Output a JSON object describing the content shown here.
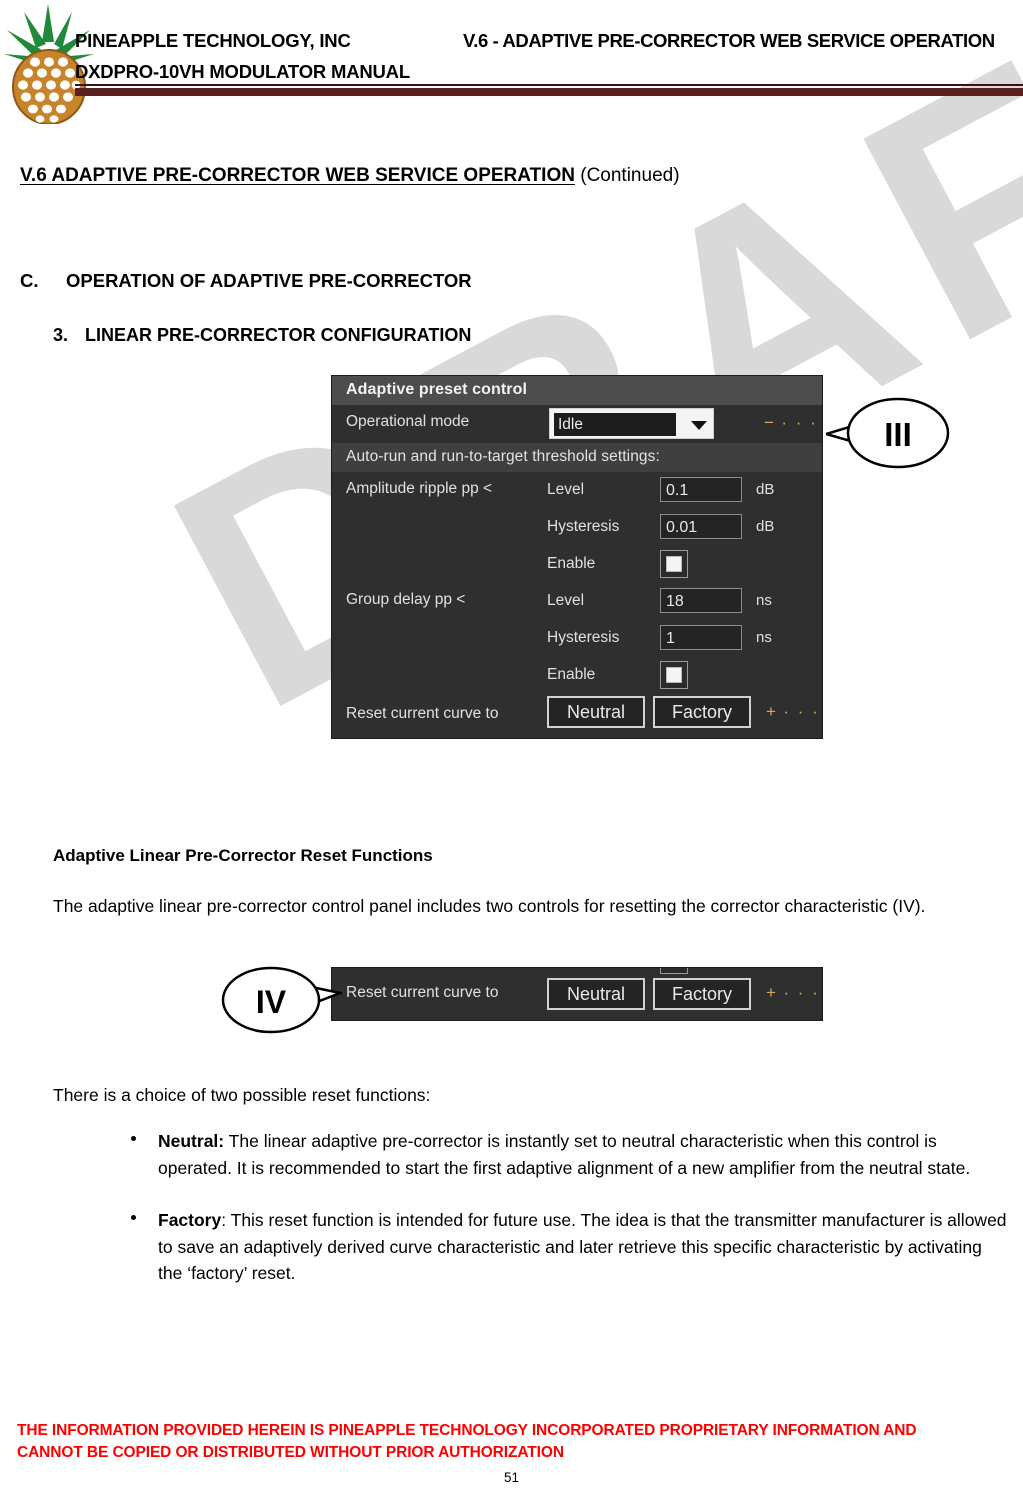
{
  "header": {
    "company_line1": "PINEAPPLE TECHNOLOGY, INC",
    "company_line2": "DXDPRO-10VH MODULATOR MANUAL",
    "right_title": "V.6 - ADAPTIVE PRE-CORRECTOR WEB SERVICE OPERATION",
    "logo_name": "pineapple-logo"
  },
  "watermark": {
    "text": "DRAFT"
  },
  "section": {
    "title_main": "V.6  ADAPTIVE PRE-CORRECTOR WEB SERVICE OPERATION",
    "title_suffix": " (Continued)",
    "heading_c_label": "C.",
    "heading_c_text": "OPERATION OF ADAPTIVE PRE-CORRECTOR",
    "heading_3_label": "3.",
    "heading_3_text": "LINEAR PRE-CORRECTOR CONFIGURATION"
  },
  "panel_main": {
    "title": "Adaptive preset control",
    "operational_mode_label": "Operational mode",
    "operational_mode_value": "Idle",
    "dropdown_icon": "chevron-down-icon",
    "subhead": "Auto-run and run-to-target threshold settings:",
    "amplitude_label": "Amplitude ripple pp <",
    "group_delay_label": "Group delay pp <",
    "rows": [
      {
        "mid": "Level",
        "value": "0.1",
        "unit": "dB"
      },
      {
        "mid": "Hysteresis",
        "value": "0.01",
        "unit": "dB"
      },
      {
        "mid": "Enable",
        "value": "",
        "unit": ""
      },
      {
        "mid": "Level",
        "value": "18",
        "unit": "ns"
      },
      {
        "mid": "Hysteresis",
        "value": "1",
        "unit": "ns"
      },
      {
        "mid": "Enable",
        "value": "",
        "unit": ""
      }
    ],
    "reset_label": "Reset current curve to",
    "btn_neutral": "Neutral",
    "btn_factory": "Factory",
    "dots_minus": "− · · ·",
    "dots_plus": "+ · · ·"
  },
  "panel_reset": {
    "reset_label": "Reset current curve to",
    "btn_neutral": "Neutral",
    "btn_factory": "Factory",
    "dots_plus": "+ · · ·"
  },
  "callouts": {
    "three": "III",
    "four": "IV"
  },
  "body_text": {
    "sub_heading": "Adaptive Linear Pre-Corrector Reset Functions",
    "para1": "The adaptive linear pre-corrector control panel includes two controls for resetting the corrector characteristic (IV).",
    "para2": "There is a choice of two possible reset functions:",
    "bullet1_term": "Neutral:",
    "bullet1_text": " The linear adaptive pre-corrector is instantly set to neutral characteristic when this control is operated. It is recommended to start the first adaptive alignment of a new amplifier from the neutral state.",
    "bullet2_term": "Factory",
    "bullet2_text": ": This reset function is intended for future use. The idea is that the transmitter manufacturer is allowed to save an adaptively derived curve characteristic and later retrieve this specific characteristic by activating the ‘factory’ reset."
  },
  "footer": {
    "line1": "THE INFORMATION PROVIDED HEREIN IS PINEAPPLE TECHNOLOGY INCORPORATED PROPRIETARY INFORMATION AND",
    "line2": "CANNOT BE COPIED OR DISTRIBUTED WITHOUT PRIOR AUTHORIZATION",
    "page_number": "51"
  },
  "colors": {
    "rule": "#5c1f1f",
    "footer_red": "#ff0000",
    "panel_bg": "#2f2f2f",
    "panel_header": "#4d4d4d",
    "accent_orange": "#d8a55a",
    "logo_green": "#1f8a3c",
    "logo_body": "#c8842a"
  }
}
